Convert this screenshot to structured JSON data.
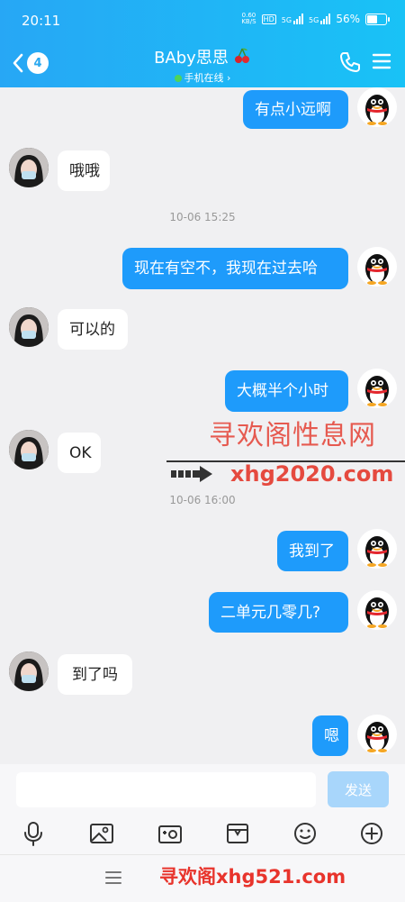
{
  "status_bar": {
    "time": "20:11",
    "net_speed": "0.60",
    "net_unit": "KB/S",
    "battery": "56%",
    "net1": "5G",
    "net2": "5G",
    "hd": "HD"
  },
  "header": {
    "unread_count": "4",
    "contact_name": "BAby思思",
    "status": "手机在线"
  },
  "messages": {
    "m1": "有点小远啊",
    "m2": "哦哦",
    "ts1": "10-06 15:25",
    "m3": "现在有空不，我现在过去哈",
    "m4": "可以的",
    "m5": "大概半个小时",
    "m6": "OK",
    "ts2": "10-06 16:00",
    "m7": "我到了",
    "m8": "二单元几零几?",
    "m9": "到了吗",
    "m10": "嗯"
  },
  "watermarks": {
    "w1": "寻欢阁性息网",
    "w2": "xhg2020.com",
    "w3": "寻欢阁xhg521.com"
  },
  "input": {
    "send_label": "发送"
  },
  "colors": {
    "header": "#1fb4f6",
    "out_bubble": "#1e9bfb",
    "watermark": "#e54a3f"
  },
  "icons": [
    "back-icon",
    "phone-icon",
    "menu-icon",
    "microphone-icon",
    "image-icon",
    "camera-icon",
    "gift-icon",
    "emoji-icon",
    "plus-icon",
    "nav-menu-icon"
  ]
}
